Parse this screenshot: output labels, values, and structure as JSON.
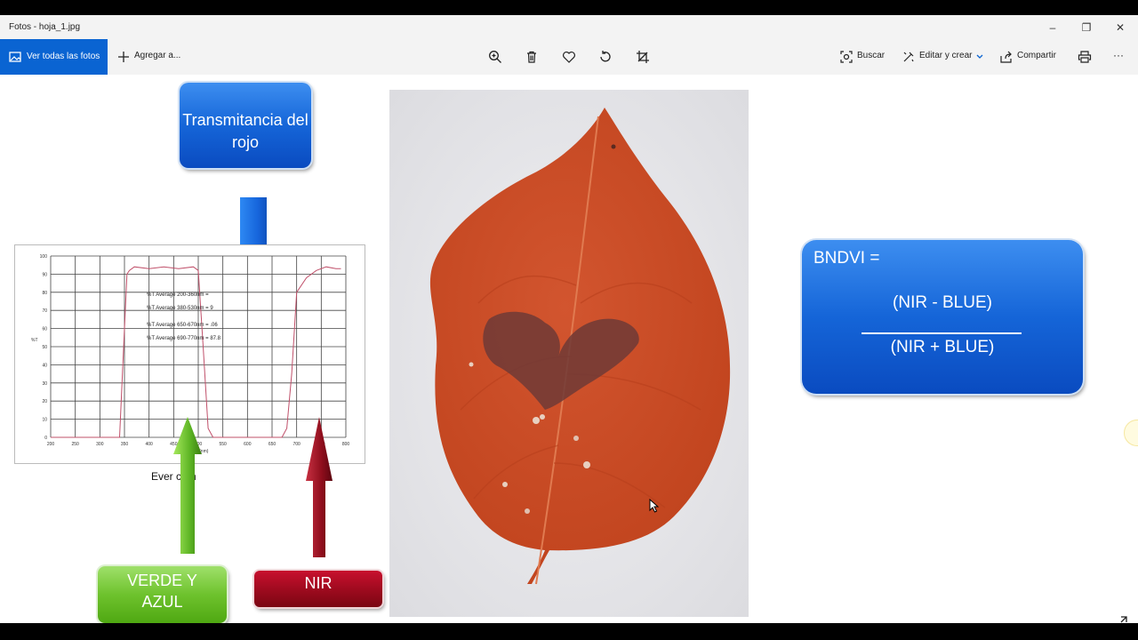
{
  "window": {
    "title": "Fotos - hoja_1.jpg",
    "minimize": "–",
    "restore": "❐",
    "close": "✕"
  },
  "toolbar": {
    "view_all": "Ver todas las fotos",
    "add_to": "Agregar a...",
    "search": "Buscar",
    "edit_create": "Editar y crear",
    "share": "Compartir",
    "more": "···"
  },
  "slide": {
    "transmitancia": "Transmitancia del rojo",
    "verde_azul": "VERDE Y AZUL",
    "nir": "NIR",
    "caption": "Ever    com",
    "formula": {
      "lhs": "BNDVI =",
      "numerator": "(NIR  - BLUE)",
      "denominator": "(NIR + BLUE)"
    }
  },
  "chart_data": {
    "type": "line",
    "x_ticks": [
      "200",
      "250",
      "300",
      "350",
      "400",
      "450",
      "500",
      "550",
      "600",
      "650",
      "700",
      "750",
      "800"
    ],
    "y_ticks": [
      "0",
      "10",
      "20",
      "30",
      "40",
      "50",
      "60",
      "70",
      "80",
      "90",
      "100"
    ],
    "xlabel": "ngth (nm)",
    "ylabel": "%T",
    "xlim": [
      200,
      800
    ],
    "ylim": [
      0,
      100
    ],
    "annotations": [
      "%T Average 200-360nm = ",
      "%T Average 380-530nm = 9",
      "%T Average 650-670nm = .06",
      "%T Average 690-770nm = 87.8"
    ],
    "series": [
      {
        "x": [
          200,
          340,
          350,
          355,
          360,
          370,
          400,
          430,
          460,
          490,
          500,
          510,
          520,
          530,
          540,
          560,
          580,
          600,
          620,
          640,
          650,
          670,
          680,
          690,
          700,
          720,
          740,
          760,
          780,
          790
        ],
        "y": [
          0,
          0,
          60,
          90,
          92,
          94,
          93,
          94,
          93,
          94,
          92,
          50,
          5,
          0,
          0,
          0,
          0,
          0,
          0,
          0,
          0,
          0,
          5,
          35,
          80,
          88,
          92,
          94,
          93,
          93
        ]
      }
    ]
  },
  "colors": {
    "accent": "#0a64d2",
    "leaf": "#d5502a",
    "chart_line": "#c0506a"
  }
}
